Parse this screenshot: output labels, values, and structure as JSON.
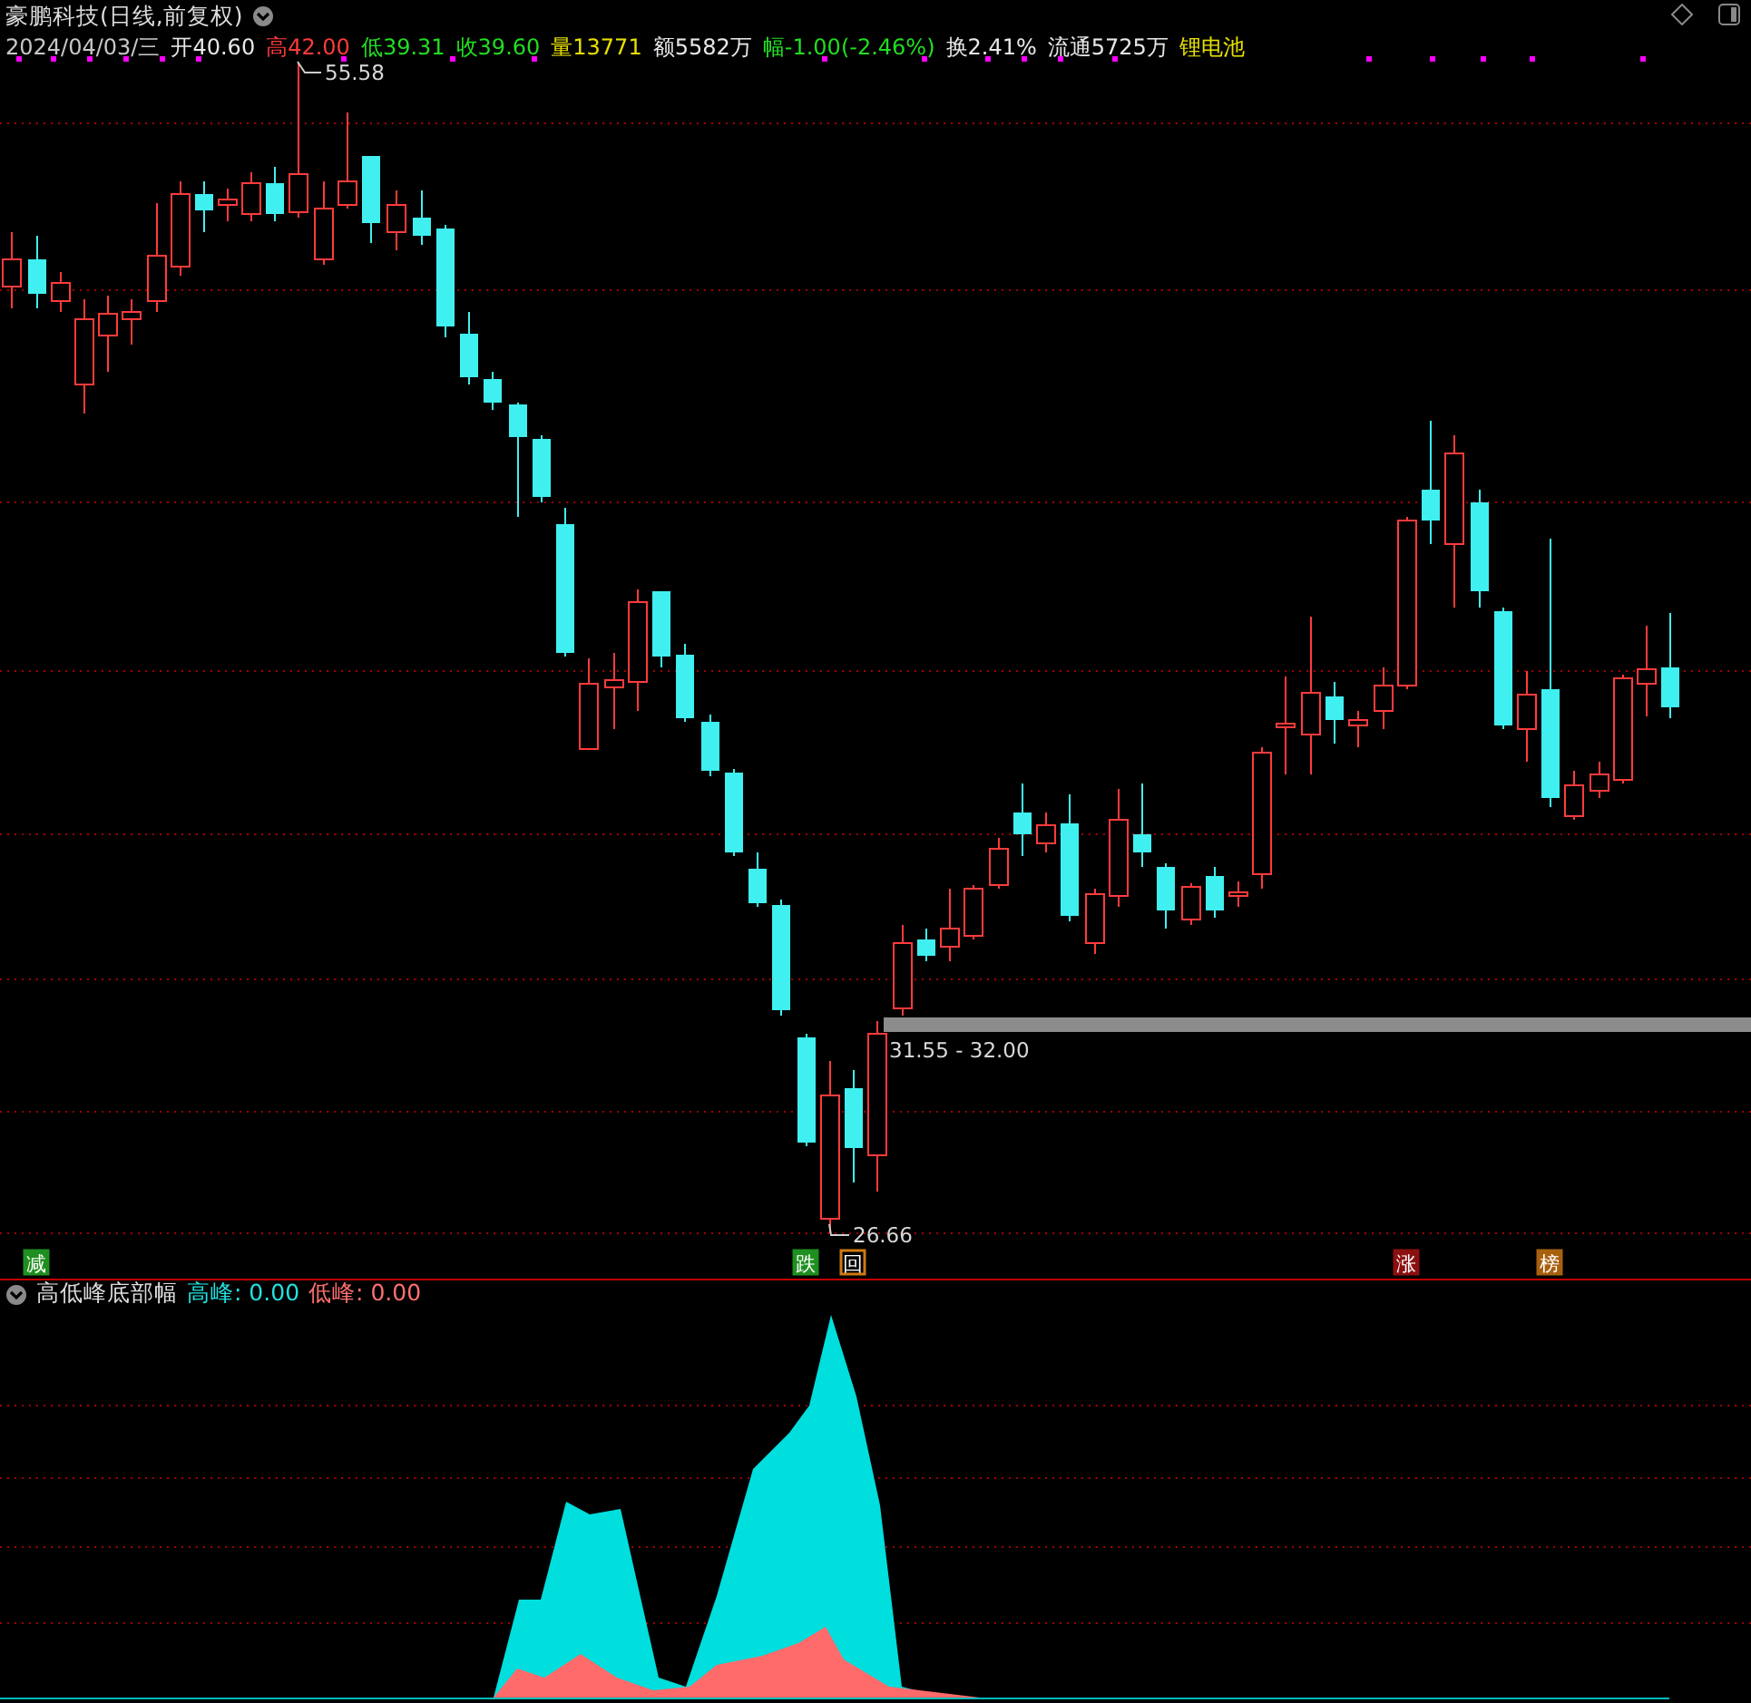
{
  "title": "豪鹏科技(日线,前复权)",
  "quote": [
    {
      "value": "2024/04/03/三",
      "color": "#c8c8c8"
    },
    {
      "label": "开",
      "value": "40.60",
      "color": "#e8e8e8"
    },
    {
      "label": "高",
      "value": "42.00",
      "color": "#ff3b3b"
    },
    {
      "label": "低",
      "value": "39.31",
      "color": "#22dd22"
    },
    {
      "label": "收",
      "value": "39.60",
      "color": "#22dd22"
    },
    {
      "label": "量",
      "value": "13771",
      "color": "#e8e000"
    },
    {
      "label": "额",
      "value": "5582万",
      "color": "#e8e8e8"
    },
    {
      "label": "幅",
      "value": "-1.00(-2.46%)",
      "color": "#22dd22"
    },
    {
      "label": "换",
      "value": "2.41%",
      "color": "#e8e8e8"
    },
    {
      "label": "流通",
      "value": "5725万",
      "color": "#e8e8e8"
    },
    {
      "value": "锂电池",
      "color": "#e8e000"
    }
  ],
  "price_labels": [
    {
      "kind": "high",
      "text": "55.58"
    },
    {
      "kind": "low",
      "text": "26.66"
    },
    {
      "kind": "range",
      "text": "31.55 - 32.00"
    }
  ],
  "markers": [
    {
      "text": "减",
      "kind": "filled",
      "color": "#1f8f1f"
    },
    {
      "text": "跌",
      "kind": "filled",
      "color": "#1f8f1f"
    },
    {
      "text": "回",
      "kind": "outlined",
      "color": "#d07a10"
    },
    {
      "text": "涨",
      "kind": "filled",
      "color": "#8c1010"
    },
    {
      "text": "榜",
      "kind": "filled",
      "color": "#a8600f"
    }
  ],
  "indicator": {
    "name": "高低峰底部幅",
    "values": [
      {
        "label": "高峰:",
        "value": "0.00",
        "color": "#22e0e0"
      },
      {
        "label": "低峰:",
        "value": "0.00",
        "color": "#ff7070"
      }
    ]
  }
}
